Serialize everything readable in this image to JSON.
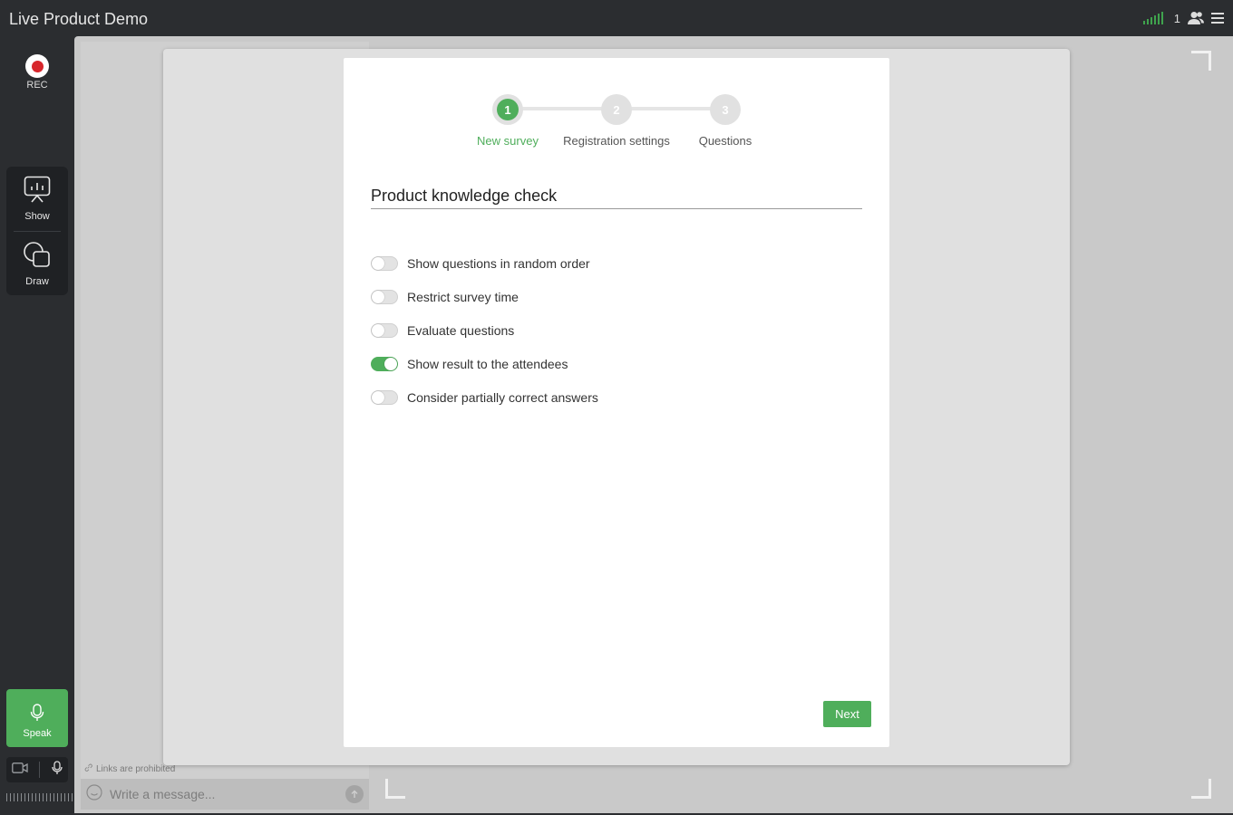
{
  "app": {
    "title": "Live Product Demo"
  },
  "topbar": {
    "participant_count": "1"
  },
  "rail": {
    "rec_label": "REC",
    "tools": [
      {
        "label": "Show",
        "icon": "presentation-icon"
      },
      {
        "label": "Draw",
        "icon": "shapes-icon"
      }
    ],
    "speak_label": "Speak"
  },
  "chat": {
    "links_note": "Links are prohibited",
    "placeholder": "Write a message..."
  },
  "wizard": {
    "steps": [
      {
        "number": "1",
        "label": "New survey",
        "active": true
      },
      {
        "number": "2",
        "label": "Registration settings",
        "active": false
      },
      {
        "number": "3",
        "label": "Questions",
        "active": false
      }
    ],
    "survey_title": "Product knowledge check",
    "options": [
      {
        "label": "Show questions in random order",
        "enabled": false
      },
      {
        "label": "Restrict survey time",
        "enabled": false
      },
      {
        "label": "Evaluate questions",
        "enabled": false
      },
      {
        "label": "Show result to the attendees",
        "enabled": true
      },
      {
        "label": "Consider partially correct answers",
        "enabled": false
      }
    ],
    "next_label": "Next"
  },
  "colors": {
    "accent": "#4fae5b",
    "record": "#d7262c",
    "chrome": "#2b2d30"
  }
}
